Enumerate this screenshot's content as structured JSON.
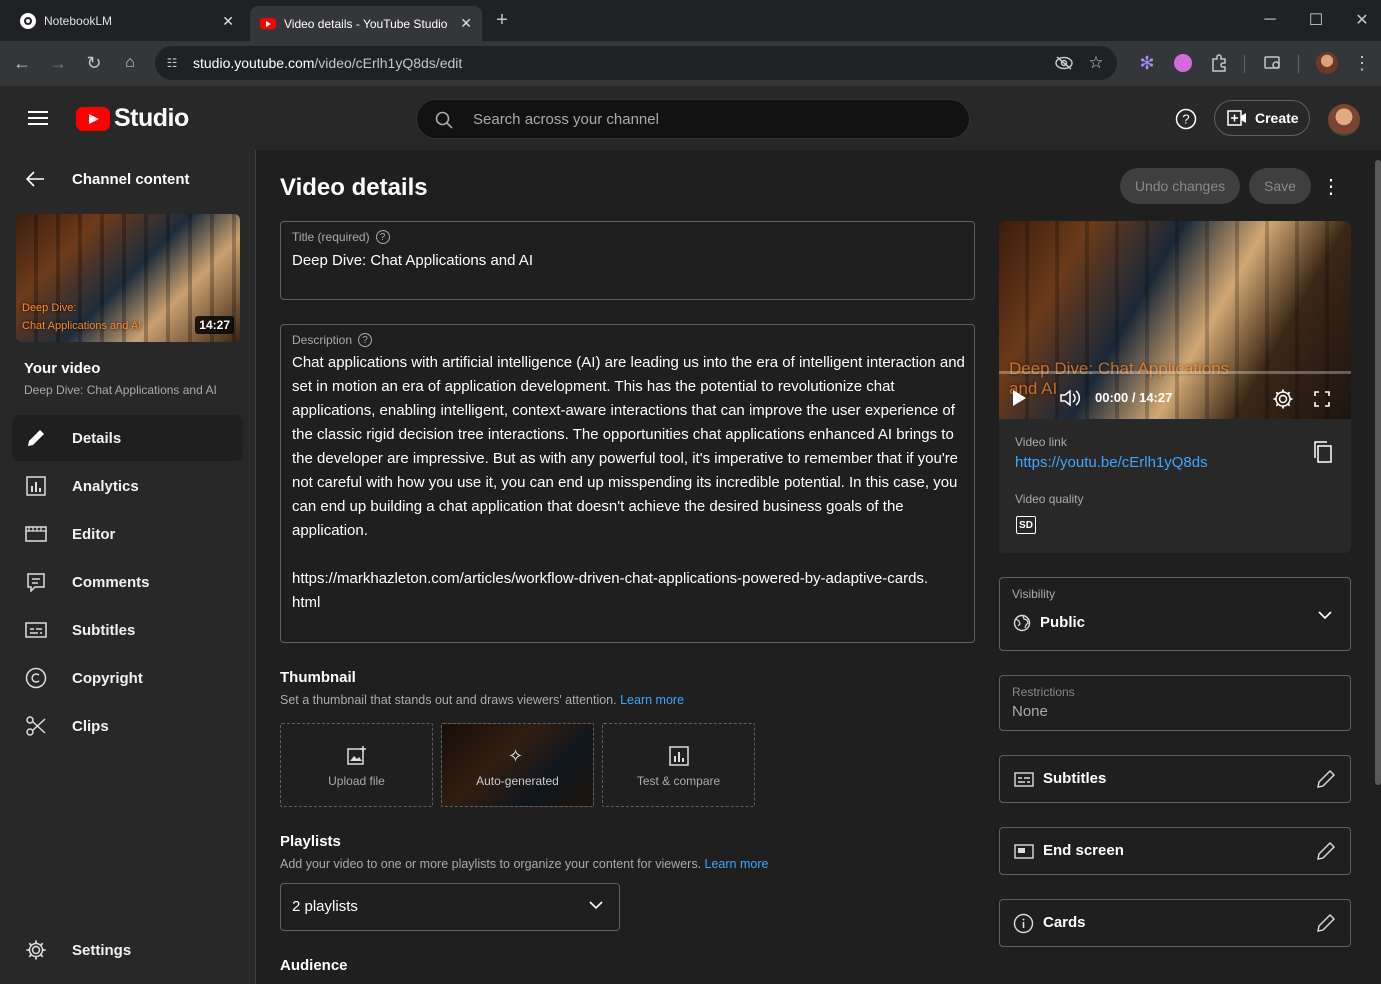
{
  "browser": {
    "tabs": [
      {
        "title": "NotebookLM"
      },
      {
        "title": "Video details - YouTube Studio"
      }
    ],
    "url_host": "studio.youtube.com",
    "url_path": "/video/cErlh1yQ8ds/edit"
  },
  "header": {
    "logo_text": "Studio",
    "search_placeholder": "Search across your channel",
    "create_label": "Create"
  },
  "sidebar": {
    "back_label": "Channel content",
    "thumb_overlay_line1": "Deep Dive:",
    "thumb_overlay_line2": "Chat Applications and AI",
    "thumb_duration": "14:27",
    "your_video_label": "Your video",
    "video_title": "Deep Dive: Chat Applications and AI",
    "items": [
      {
        "label": "Details",
        "icon": "pencil-icon"
      },
      {
        "label": "Analytics",
        "icon": "analytics-icon"
      },
      {
        "label": "Editor",
        "icon": "film-icon"
      },
      {
        "label": "Comments",
        "icon": "comments-icon"
      },
      {
        "label": "Subtitles",
        "icon": "subtitles-icon"
      },
      {
        "label": "Copyright",
        "icon": "copyright-icon"
      },
      {
        "label": "Clips",
        "icon": "scissors-icon"
      }
    ],
    "settings_label": "Settings"
  },
  "main": {
    "page_title": "Video details",
    "undo_label": "Undo changes",
    "save_label": "Save",
    "title_field": {
      "label": "Title (required)",
      "value": "Deep Dive: Chat Applications and AI"
    },
    "description_field": {
      "label": "Description",
      "value": "Chat applications with artificial intelligence (AI) are leading us into the era of intelligent interaction and set in motion an era of application development. This has the potential to revolutionize chat applications, enabling intelligent, context-aware interactions that can improve the user experience of the classic rigid decision tree interactions. The opportunities chat applications enhanced AI brings to the developer are impressive. But as with any powerful tool, it's imperative to remember that if you're not careful with how you use it, you can end up misspending its incredible potential. In this case, you can end up building a chat application that doesn't achieve the desired business goals of the application.",
      "link": "https://markhazleton.com/articles/workflow-driven-chat-applications-powered-by-adaptive-cards.html"
    },
    "thumbnail": {
      "heading": "Thumbnail",
      "desc": "Set a thumbnail that stands out and draws viewers' attention.",
      "learn_more": "Learn more",
      "options": [
        {
          "label": "Upload file"
        },
        {
          "label": "Auto-generated"
        },
        {
          "label": "Test & compare"
        }
      ]
    },
    "playlists": {
      "heading": "Playlists",
      "desc": "Add your video to one or more playlists to organize your content for viewers.",
      "learn_more": "Learn more",
      "value": "2 playlists"
    },
    "audience_heading": "Audience"
  },
  "preview": {
    "overlay_text": "Deep Dive: Chat Applications and AI",
    "time": "00:00 / 14:27",
    "video_link_label": "Video link",
    "video_link": "https://youtu.be/cErlh1yQ8ds",
    "quality_label": "Video quality",
    "quality_badge": "SD",
    "progress": 0
  },
  "visibility": {
    "label": "Visibility",
    "value": "Public"
  },
  "restrictions": {
    "label": "Restrictions",
    "value": "None"
  },
  "side_buttons": [
    {
      "label": "Subtitles"
    },
    {
      "label": "End screen"
    },
    {
      "label": "Cards"
    }
  ],
  "colors": {
    "youtube_red": "#ff0000",
    "link_blue": "#3ea6ff"
  }
}
